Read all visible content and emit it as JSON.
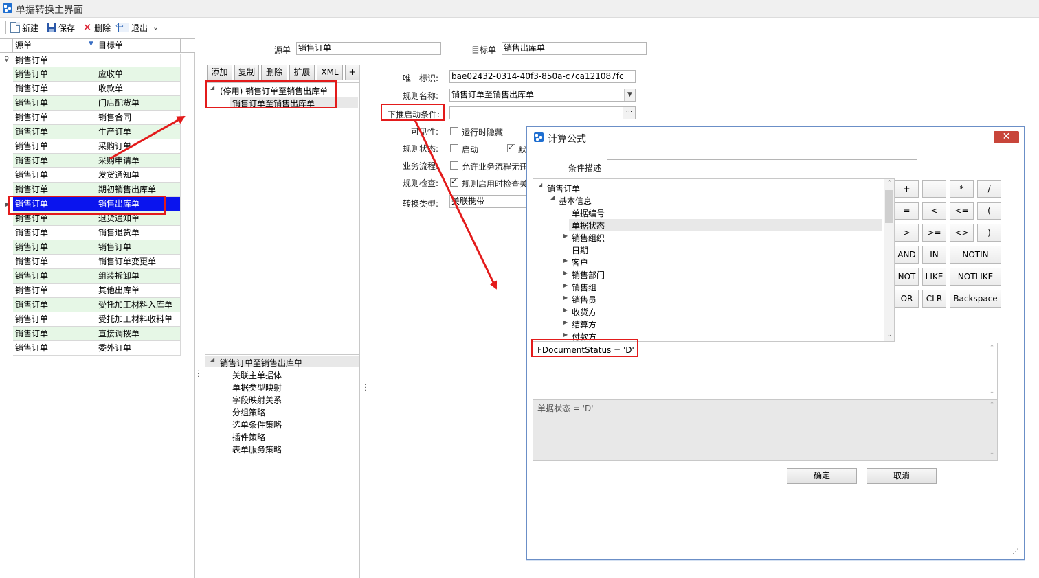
{
  "window": {
    "title": "单据转换主界面"
  },
  "toolbar": {
    "new_label": "新建",
    "save_label": "保存",
    "delete_label": "删除",
    "exit_label": "退出"
  },
  "grid": {
    "col_source": "源单",
    "col_target": "目标单",
    "filter_value": "销售订单",
    "rows": [
      {
        "source": "销售订单",
        "target": "应收单"
      },
      {
        "source": "销售订单",
        "target": "收款单"
      },
      {
        "source": "销售订单",
        "target": "门店配货单"
      },
      {
        "source": "销售订单",
        "target": "销售合同"
      },
      {
        "source": "销售订单",
        "target": "生产订单"
      },
      {
        "source": "销售订单",
        "target": "采购订单"
      },
      {
        "source": "销售订单",
        "target": "采购申请单"
      },
      {
        "source": "销售订单",
        "target": "发货通知单"
      },
      {
        "source": "销售订单",
        "target": "期初销售出库单"
      },
      {
        "source": "销售订单",
        "target": "销售出库单"
      },
      {
        "source": "销售订单",
        "target": "退货通知单"
      },
      {
        "source": "销售订单",
        "target": "销售退货单"
      },
      {
        "source": "销售订单",
        "target": "销售订单"
      },
      {
        "source": "销售订单",
        "target": "销售订单变更单"
      },
      {
        "source": "销售订单",
        "target": "组装拆卸单"
      },
      {
        "source": "销售订单",
        "target": "其他出库单"
      },
      {
        "source": "销售订单",
        "target": "受托加工材料入库单"
      },
      {
        "source": "销售订单",
        "target": "受托加工材料收料单"
      },
      {
        "source": "销售订单",
        "target": "直接调拨单"
      },
      {
        "source": "销售订单",
        "target": "委外订单"
      }
    ]
  },
  "header": {
    "source_label": "源单",
    "source_value": "销售订单",
    "target_label": "目标单",
    "target_value": "销售出库单"
  },
  "rule_buttons": {
    "add": "添加",
    "copy": "复制",
    "delete": "删除",
    "extend": "扩展",
    "xml": "XML",
    "plus": "+"
  },
  "rule_tree": {
    "parent": "(停用) 销售订单至销售出库单",
    "child": "销售订单至销售出库单"
  },
  "policy_tree": {
    "root": "销售订单至销售出库单",
    "items": [
      "关联主单据体",
      "单据类型映射",
      "字段映射关系",
      "分组策略",
      "选单条件策略",
      "插件策略",
      "表单服务策略"
    ]
  },
  "form": {
    "uid_label": "唯一标识:",
    "uid_value": "bae02432-0314-40f3-850a-c7ca121087fc",
    "rule_name_label": "规则名称:",
    "rule_name_value": "销售订单至销售出库单",
    "push_condition_label": "下推启动条件:",
    "push_condition_value": "",
    "ellipsis": "···",
    "visibility_label": "可见性:",
    "visibility_option": "运行时隐藏",
    "rule_status_label": "规则状态:",
    "rule_status_enabled": "启动",
    "rule_status_default": "默",
    "business_flow_label": "业务流程:",
    "business_flow_option": "允许业务流程无违",
    "rule_check_label": "规则检查:",
    "rule_check_option": "规则启用时检查关",
    "convert_type_label": "转换类型:",
    "convert_type_value": "关联携带"
  },
  "dialog": {
    "title": "计算公式",
    "close": "✕",
    "condition_desc_label": "条件描述",
    "condition_desc_value": "",
    "tree_root": "销售订单",
    "tree_group": "基本信息",
    "tree_items": [
      {
        "label": "单据编号",
        "expandable": false
      },
      {
        "label": "单据状态",
        "expandable": false
      },
      {
        "label": "销售组织",
        "expandable": true
      },
      {
        "label": "日期",
        "expandable": false
      },
      {
        "label": "客户",
        "expandable": true
      },
      {
        "label": "销售部门",
        "expandable": true
      },
      {
        "label": "销售组",
        "expandable": true
      },
      {
        "label": "销售员",
        "expandable": true
      },
      {
        "label": "收货方",
        "expandable": true
      },
      {
        "label": "结算方",
        "expandable": true
      },
      {
        "label": "付款方",
        "expandable": true
      }
    ],
    "keypad": {
      "plus": "+",
      "minus": "-",
      "times": "*",
      "divide": "/",
      "eq": "=",
      "lt": "<",
      "le": "<=",
      "lparen": "(",
      "gt": ">",
      "ge": ">=",
      "ne": "<>",
      "rparen": ")",
      "and": "AND",
      "in": "IN",
      "notin": "NOTIN",
      "not": "NOT",
      "like": "LIKE",
      "notlike": "NOTLIKE",
      "or": "OR",
      "clr": "CLR",
      "backspace": "Backspace"
    },
    "formula_text": "FDocumentStatus = 'D'",
    "preview_text": "单据状态 = 'D'",
    "ok_label": "确定",
    "cancel_label": "取消"
  },
  "colors": {
    "selection": "#0a14ee",
    "row_alt": "#e6f7e6",
    "annotation": "#e31b1b"
  }
}
